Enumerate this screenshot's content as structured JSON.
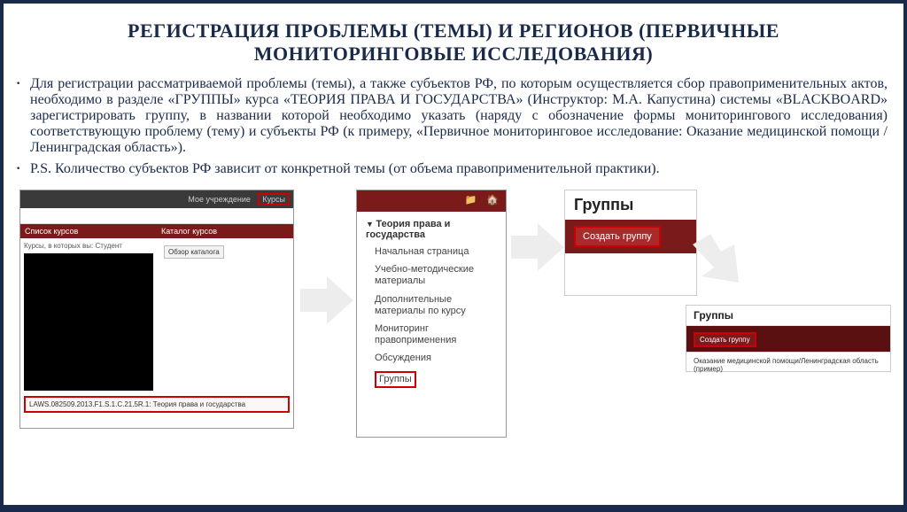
{
  "title": "РЕГИСТРАЦИЯ ПРОБЛЕМЫ (ТЕМЫ) И РЕГИОНОВ (ПЕРВИЧНЫЕ МОНИТОРИНГОВЫЕ ИССЛЕДОВАНИЯ)",
  "bullets": [
    "Для регистрации рассматриваемой проблемы (темы), а также субъектов РФ, по которым осуществляется сбор правоприменительных актов, необходимо в разделе «ГРУППЫ» курса «ТЕОРИЯ ПРАВА И ГОСУДАРСТВА» (Инструктор: М.А. Капустина) системы «BLACKBOARD» зарегистрировать группу, в названии которой необходимо указать (наряду с обозначение формы мониторингового исследования) соответствующую проблему (тему) и субъекты РФ (к примеру, «Первичное мониторинговое исследование: Оказание медицинской помощи / Ленинградская область»).",
    "P.S. Количество субъектов РФ зависит от конкретной темы (от объема правоприменительной практики)."
  ],
  "shot1": {
    "nav1": "Мое учреждение",
    "nav2": "Курсы",
    "col1": "Список курсов",
    "col1text": "Курсы, в которых вы: Студент",
    "col2": "Каталог курсов",
    "col2btn": "Обзор каталога",
    "bottom": "LAWS.082509.2013.F1.S.1.C.21.5R.1: Теория права и государства"
  },
  "shot2": {
    "header": "Теория права и государства",
    "items": {
      "i1": "Начальная страница",
      "i2": "Учебно-методические материалы",
      "i3": "Дополнительные материалы по курсу",
      "i4": "Мониторинг правоприменения",
      "i5": "Обсуждения",
      "i6": "Группы"
    }
  },
  "shot3": {
    "title": "Группы",
    "button": "Создать группу"
  },
  "shot4": {
    "title": "Группы",
    "button": "Создать группу",
    "row": "Оказание медицинской помощи/Ленинградская область (пример)"
  }
}
